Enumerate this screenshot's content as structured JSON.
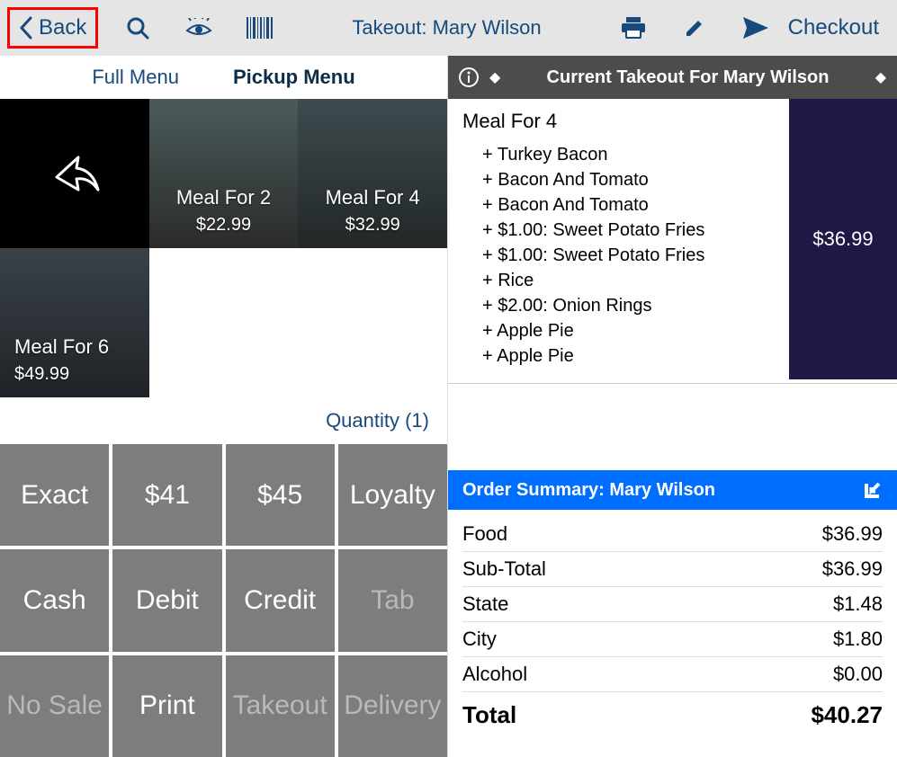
{
  "toolbar": {
    "back_label": "Back",
    "title": "Takeout: Mary Wilson",
    "checkout_label": "Checkout"
  },
  "menu_tabs": {
    "full": "Full Menu",
    "pickup": "Pickup Menu"
  },
  "tiles": [
    {
      "name": "Meal For 2",
      "price": "$22.99"
    },
    {
      "name": "Meal For 4",
      "price": "$32.99"
    },
    {
      "name": "Meal For 6",
      "price": "$49.99"
    }
  ],
  "quantity_label": "Quantity (1)",
  "keypad": {
    "exact": "Exact",
    "amt1": "$41",
    "amt2": "$45",
    "loyalty": "Loyalty",
    "cash": "Cash",
    "debit": "Debit",
    "credit": "Credit",
    "tab": "Tab",
    "nosale": "No Sale",
    "print": "Print",
    "takeout": "Takeout",
    "delivery": "Delivery"
  },
  "current_takeout_label": "Current Takeout For Mary Wilson",
  "ticket": {
    "meal_name": "Meal For 4",
    "price": "$36.99",
    "modifiers": [
      "+ Turkey Bacon",
      "+ Bacon And Tomato",
      "+ Bacon And Tomato",
      "+ $1.00: Sweet Potato Fries",
      "+ $1.00: Sweet Potato Fries",
      "+ Rice",
      "+ $2.00: Onion Rings",
      "+ Apple Pie",
      "+ Apple Pie"
    ]
  },
  "summary_title": "Order Summary: Mary Wilson",
  "summary": [
    {
      "label": "Food",
      "value": "$36.99"
    },
    {
      "label": "Sub-Total",
      "value": "$36.99"
    },
    {
      "label": "State",
      "value": "$1.48"
    },
    {
      "label": "City",
      "value": "$1.80"
    },
    {
      "label": "Alcohol",
      "value": "$0.00"
    },
    {
      "label": "Total",
      "value": "$40.27"
    }
  ]
}
